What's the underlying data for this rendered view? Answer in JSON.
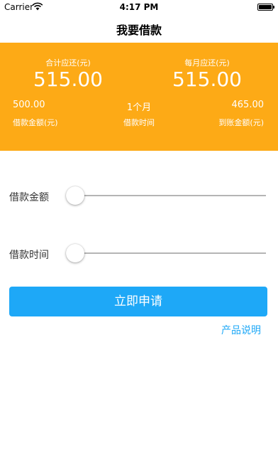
{
  "status_bar": {
    "carrier": "Carrier",
    "time": "4:17 PM"
  },
  "nav": {
    "title": "我要借款"
  },
  "summary": {
    "total_label": "合计应还(元)",
    "total_value": "515.00",
    "monthly_label": "每月应还(元)",
    "monthly_value": "515.00",
    "loan_amount_value": "500.00",
    "loan_amount_label": "借款金额(元)",
    "loan_term_value": "1个月",
    "loan_term_label": "借款时间",
    "received_value": "465.00",
    "received_label": "到账金额(元)"
  },
  "sliders": {
    "amount_label": "借款金额",
    "amount_position": 0,
    "time_label": "借款时间",
    "time_position": 0
  },
  "actions": {
    "apply_label": "立即申请",
    "product_link": "产品说明"
  },
  "colors": {
    "panel": "#fdaa16",
    "accent": "#1ea8f7"
  },
  "icons": {
    "wifi": "wifi-icon",
    "battery": "battery-icon"
  }
}
